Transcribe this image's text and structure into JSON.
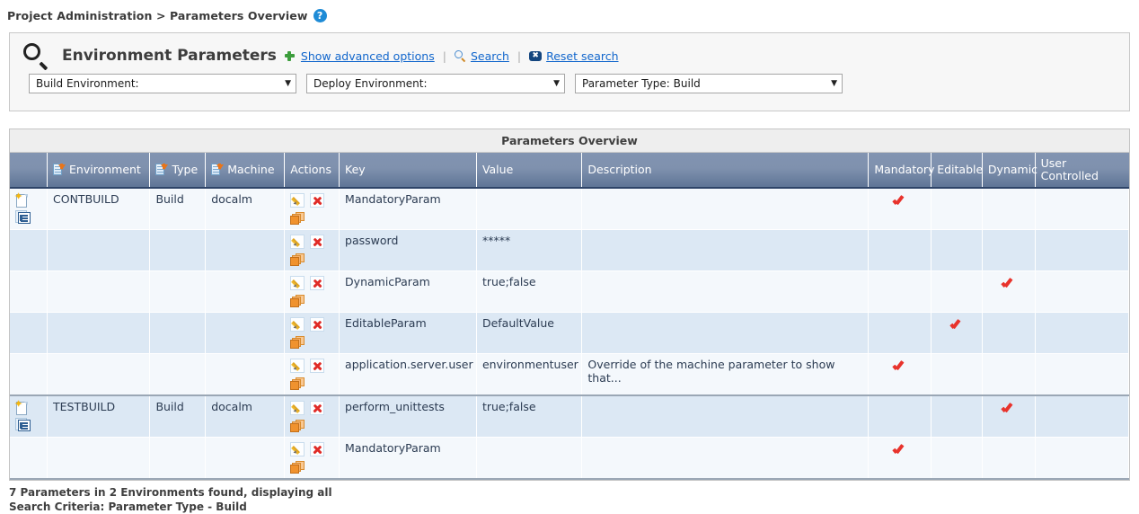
{
  "breadcrumb": {
    "text": "Project Administration > Parameters Overview",
    "help_icon": "help-icon",
    "help_label": "?"
  },
  "search_panel": {
    "icon": "search-icon",
    "title": "Environment Parameters",
    "links": [
      {
        "label": "Show advanced options",
        "icon": "expand-plus-icon"
      },
      {
        "label": "Search",
        "icon": "search-icon"
      },
      {
        "label": "Reset search",
        "icon": "reset-icon"
      }
    ],
    "link_separator": "|",
    "reset_icon_glyph": "✖",
    "filters": [
      {
        "name": "build-environment",
        "value": "Build Environment:",
        "caret": "▼"
      },
      {
        "name": "deploy-environment",
        "value": "Deploy Environment:",
        "caret": "▼"
      },
      {
        "name": "parameter-type",
        "value": "Parameter Type: Build",
        "caret": "▼"
      }
    ]
  },
  "table": {
    "caption": "Parameters Overview",
    "columns": [
      {
        "label": "",
        "sortable": false
      },
      {
        "label": "Environment",
        "sortable": true
      },
      {
        "label": "Type",
        "sortable": true
      },
      {
        "label": "Machine",
        "sortable": true
      },
      {
        "label": "Actions",
        "sortable": false
      },
      {
        "label": "Key",
        "sortable": false
      },
      {
        "label": "Value",
        "sortable": false
      },
      {
        "label": "Description",
        "sortable": false
      },
      {
        "label": "Mandatory",
        "sortable": false
      },
      {
        "label": "Editable",
        "sortable": false
      },
      {
        "label": "Dynamic",
        "sortable": false
      },
      {
        "label": "User Controlled",
        "sortable": false
      }
    ],
    "action_icons": [
      "edit-icon",
      "delete-icon",
      "copy-icon"
    ],
    "row_icons": [
      "new-document-icon",
      "details-icon"
    ],
    "check_glyph": "✔",
    "rows": [
      {
        "group_start": true,
        "environment": "CONTBUILD",
        "type": "Build",
        "machine": "docalm",
        "key": "MandatoryParam",
        "value": "",
        "description": "",
        "mandatory": true,
        "editable": false,
        "dynamic": false,
        "user_controlled": false
      },
      {
        "group_start": false,
        "environment": "",
        "type": "",
        "machine": "",
        "key": "password",
        "value": "*****",
        "description": "",
        "mandatory": false,
        "editable": false,
        "dynamic": false,
        "user_controlled": false
      },
      {
        "group_start": false,
        "environment": "",
        "type": "",
        "machine": "",
        "key": "DynamicParam",
        "value": "true;false",
        "description": "",
        "mandatory": false,
        "editable": false,
        "dynamic": true,
        "user_controlled": false
      },
      {
        "group_start": false,
        "environment": "",
        "type": "",
        "machine": "",
        "key": "EditableParam",
        "value": "DefaultValue",
        "description": "",
        "mandatory": false,
        "editable": true,
        "dynamic": false,
        "user_controlled": false
      },
      {
        "group_start": false,
        "group_end": true,
        "environment": "",
        "type": "",
        "machine": "",
        "key": "application.server.user",
        "value": "environmentuser",
        "description": "Override of the machine parameter to show that...",
        "mandatory": true,
        "editable": false,
        "dynamic": false,
        "user_controlled": false
      },
      {
        "group_start": true,
        "environment": "TESTBUILD",
        "type": "Build",
        "machine": "docalm",
        "key": "perform_unittests",
        "value": "true;false",
        "description": "",
        "mandatory": false,
        "editable": false,
        "dynamic": true,
        "user_controlled": false
      },
      {
        "group_start": false,
        "group_end": true,
        "environment": "",
        "type": "",
        "machine": "",
        "key": "MandatoryParam",
        "value": "",
        "description": "",
        "mandatory": true,
        "editable": false,
        "dynamic": false,
        "user_controlled": false
      }
    ]
  },
  "footer": {
    "line1": "7 Parameters in 2 Environments found, displaying all",
    "line2": "Search Criteria: Parameter Type - Build"
  }
}
